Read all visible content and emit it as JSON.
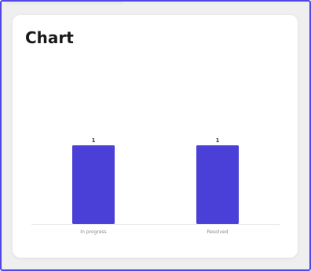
{
  "card": {
    "title": "Chart"
  },
  "chart_data": {
    "type": "bar",
    "categories": [
      "In progress",
      "Resolved"
    ],
    "values": [
      1,
      1
    ],
    "data_labels": [
      "1",
      "1"
    ],
    "title": "",
    "xlabel": "",
    "ylabel": "",
    "ylim": [
      0,
      1
    ],
    "grid": false,
    "legend": "none",
    "bar_color": "#4a3fd6",
    "axis_color": "#e4e4e4",
    "tick_label_color": "#8a8a8a",
    "data_label_color": "#333333"
  }
}
